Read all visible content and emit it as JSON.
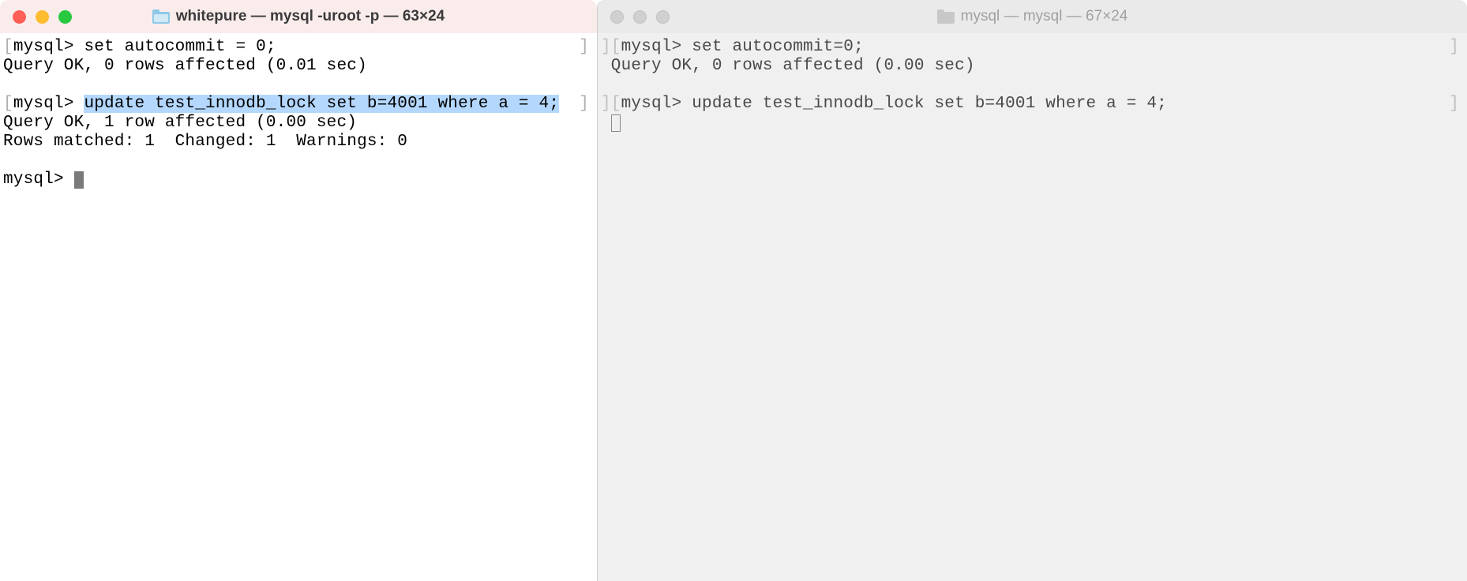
{
  "left": {
    "title": "whitepure — mysql -uroot -p — 63×24",
    "lines": {
      "l1_prefix": "[",
      "l1_prompt": "mysql> ",
      "l1_cmd": "set autocommit = 0;",
      "l1_suffix": "]",
      "l2": "Query OK, 0 rows affected (0.01 sec)",
      "l3_prefix": "[",
      "l3_prompt": "mysql> ",
      "l3_cmd": "update test_innodb_lock set b=4001 where a = 4;",
      "l3_suffix": "]",
      "l4": "Query OK, 1 row affected (0.00 sec)",
      "l5": "Rows matched: 1  Changed: 1  Warnings: 0",
      "l6_prompt": "mysql> "
    }
  },
  "right": {
    "title": "mysql — mysql — 67×24",
    "lines": {
      "l1_prefix": "][",
      "l1_prompt": "mysql> ",
      "l1_cmd": "set autocommit=0;",
      "l1_suffix": "]",
      "l2": " Query OK, 0 rows affected (0.00 sec)",
      "l3_prefix": "][",
      "l3_prompt": "mysql> ",
      "l3_cmd": "update test_innodb_lock set b=4001 where a = 4;",
      "l3_suffix": "]"
    }
  }
}
